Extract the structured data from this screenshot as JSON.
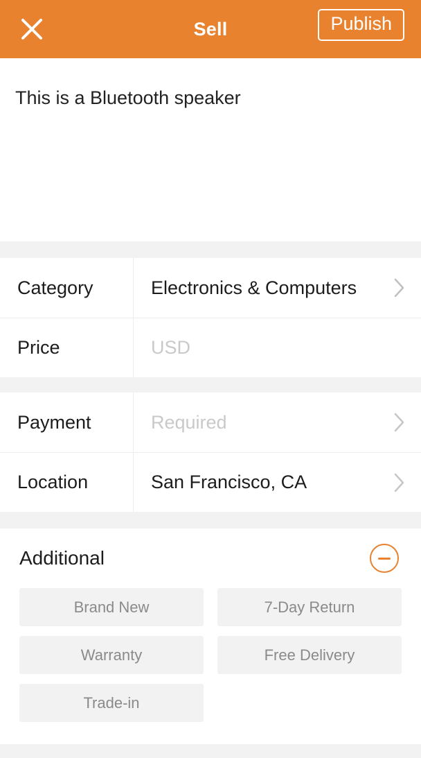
{
  "header": {
    "close_icon": "close-icon",
    "title": "Sell",
    "publish_label": "Publish",
    "background_color": "#e8822f",
    "text_color": "#ffffff"
  },
  "description": {
    "text": "This is a Bluetooth speaker"
  },
  "fields_group_one": [
    {
      "label": "Category",
      "value": "Electronics & Computers",
      "is_placeholder": false,
      "has_chevron": true
    },
    {
      "label": "Price",
      "value": "USD",
      "is_placeholder": true,
      "has_chevron": false
    }
  ],
  "fields_group_two": [
    {
      "label": "Payment",
      "value": "Required",
      "is_placeholder": true,
      "has_chevron": true
    },
    {
      "label": "Location",
      "value": "San Francisco, CA",
      "is_placeholder": false,
      "has_chevron": true
    }
  ],
  "additional": {
    "title": "Additional",
    "collapse_icon": "minus-circle-icon",
    "accent_color": "#e8822f",
    "tags": [
      "Brand New",
      "7-Day Return",
      "Warranty",
      "Free Delivery",
      "Trade-in"
    ]
  }
}
